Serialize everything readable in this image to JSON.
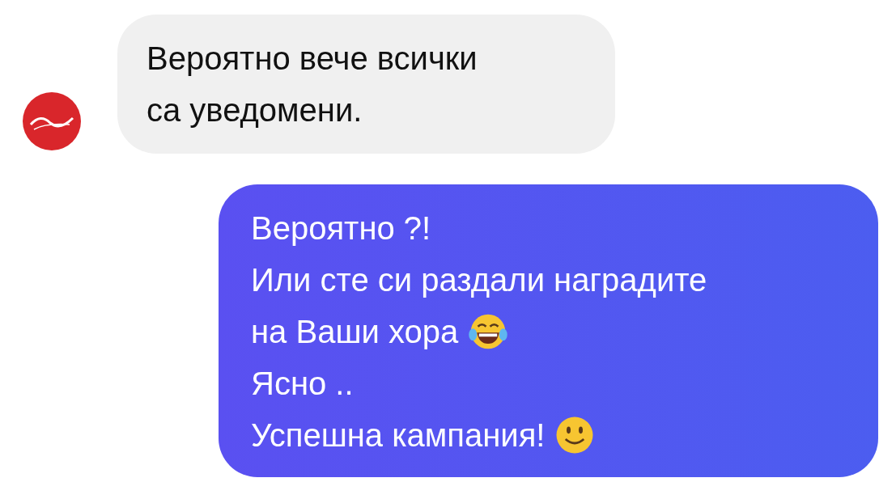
{
  "messages": [
    {
      "kind": "incoming",
      "lines": [
        {
          "kind": "plain",
          "text": "Вероятно вече всички"
        },
        {
          "kind": "plain",
          "text": "са уведомени."
        }
      ]
    },
    {
      "kind": "outgoing",
      "lines": [
        {
          "kind": "plain",
          "text": "Вероятно ?!"
        },
        {
          "kind": "plain",
          "text": "Или сте си раздали наградите"
        },
        {
          "kind": "laughing",
          "text": "на Ваши хора"
        },
        {
          "kind": "plain",
          "text": "Ясно .."
        },
        {
          "kind": "smiley",
          "text": "Успешна кампания!"
        }
      ]
    }
  ]
}
